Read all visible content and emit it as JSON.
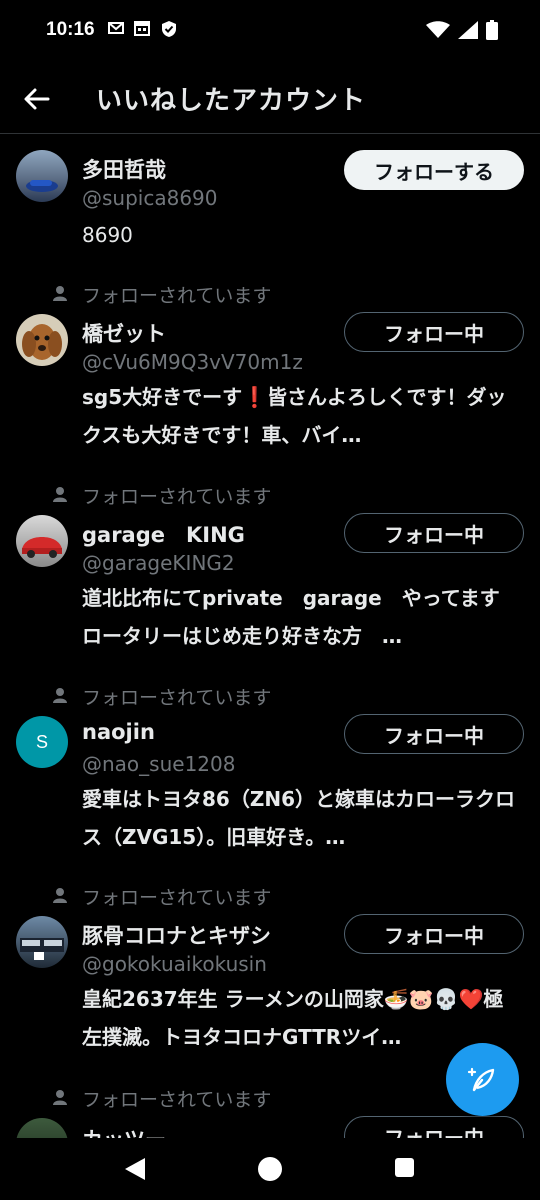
{
  "status_bar": {
    "time": "10:16",
    "left_icons": [
      "mail-icon",
      "calendar-icon",
      "shield-icon"
    ],
    "right_icons": [
      "wifi-icon",
      "signal-icon",
      "battery-icon"
    ]
  },
  "header": {
    "title": "いいねしたアカウント",
    "back_icon": "back-arrow-icon"
  },
  "followed_label": "フォローされています",
  "users": [
    {
      "name": "多田哲哉",
      "handle": "@supica8690",
      "bio": "8690",
      "follows_you": false,
      "button": "フォローする",
      "button_style": "primary",
      "avatar_color": "#3a4a6a"
    },
    {
      "name": "橋ゼット",
      "handle": "@cVu6M9Q3vV70m1z",
      "bio": "sg5大好きでーす❗皆さんよろしくです！ダックスも大好きです！車、バイ…",
      "follows_you": true,
      "button": "フォロー中",
      "button_style": "outline",
      "avatar_color": "#b07a44"
    },
    {
      "name": "garage　KING",
      "handle": "@garageKING2",
      "bio": "道北比布にてprivate　garage　やってます　ロータリーはじめ走り好きな方　…",
      "follows_you": true,
      "button": "フォロー中",
      "button_style": "outline",
      "avatar_color": "#c0392b"
    },
    {
      "name": "naojin",
      "handle": "@nao_sue1208",
      "bio": "愛車はトヨタ86（ZN6）と嫁車はカローラクロス（ZVG15）。旧車好き。…",
      "follows_you": true,
      "button": "フォロー中",
      "button_style": "outline",
      "avatar_color": "#0097a7",
      "avatar_letter": "S"
    },
    {
      "name": "豚骨コロナとキザシ",
      "handle": "@gokokuaikokusin",
      "bio": "皇紀2637年生 ラーメンの山岡家🍜🐷💀❤️極左撲滅。トヨタコロナGTTRツイ…",
      "follows_you": true,
      "button": "フォロー中",
      "button_style": "outline",
      "avatar_color": "#2c3e50"
    },
    {
      "name": "カッツー",
      "handle": "",
      "bio": "",
      "follows_you": true,
      "button": "フォロー中",
      "button_style": "outline",
      "avatar_color": "#2e4a2e"
    }
  ],
  "fab": {
    "icon": "compose-feather-icon",
    "color": "#1d9bf0"
  },
  "nav_bar": {
    "icons": [
      "nav-back-icon",
      "nav-home-icon",
      "nav-recents-icon"
    ]
  }
}
